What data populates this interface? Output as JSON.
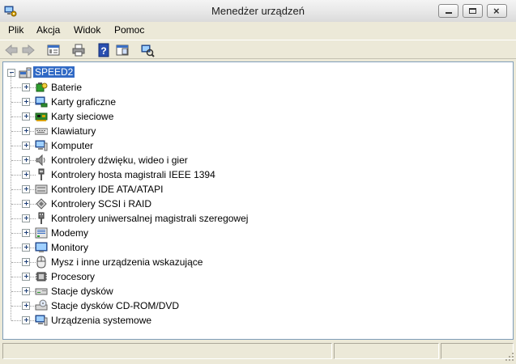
{
  "window": {
    "title": "Menedżer urządzeń"
  },
  "menu": {
    "items": [
      "Plik",
      "Akcja",
      "Widok",
      "Pomoc"
    ]
  },
  "toolbar": {
    "buttons": [
      "back-icon",
      "forward-icon",
      "properties-icon",
      "print-icon",
      "help-icon",
      "view-icon",
      "scan-hardware-icon"
    ]
  },
  "tree": {
    "root": "SPEED2",
    "items": [
      {
        "label": "Baterie",
        "icon": "battery-icon"
      },
      {
        "label": "Karty graficzne",
        "icon": "display-adapter-icon"
      },
      {
        "label": "Karty sieciowe",
        "icon": "network-card-icon"
      },
      {
        "label": "Klawiatury",
        "icon": "keyboard-icon"
      },
      {
        "label": "Komputer",
        "icon": "computer-icon"
      },
      {
        "label": "Kontrolery dźwięku, wideo i gier",
        "icon": "speaker-icon"
      },
      {
        "label": "Kontrolery hosta magistrali IEEE 1394",
        "icon": "firewire-icon"
      },
      {
        "label": "Kontrolery IDE ATA/ATAPI",
        "icon": "ide-icon"
      },
      {
        "label": "Kontrolery SCSI i RAID",
        "icon": "scsi-icon"
      },
      {
        "label": "Kontrolery uniwersalnej magistrali szeregowej",
        "icon": "usb-icon"
      },
      {
        "label": "Modemy",
        "icon": "modem-icon"
      },
      {
        "label": "Monitory",
        "icon": "monitor-icon"
      },
      {
        "label": "Mysz i inne urządzenia wskazujące",
        "icon": "mouse-icon"
      },
      {
        "label": "Procesory",
        "icon": "processor-icon"
      },
      {
        "label": "Stacje dysków",
        "icon": "disk-drive-icon"
      },
      {
        "label": "Stacje dysków CD-ROM/DVD",
        "icon": "cdrom-icon"
      },
      {
        "label": "Urządzenia systemowe",
        "icon": "system-devices-icon"
      }
    ]
  },
  "statusbar": {
    "cells": [
      "",
      "",
      ""
    ]
  }
}
